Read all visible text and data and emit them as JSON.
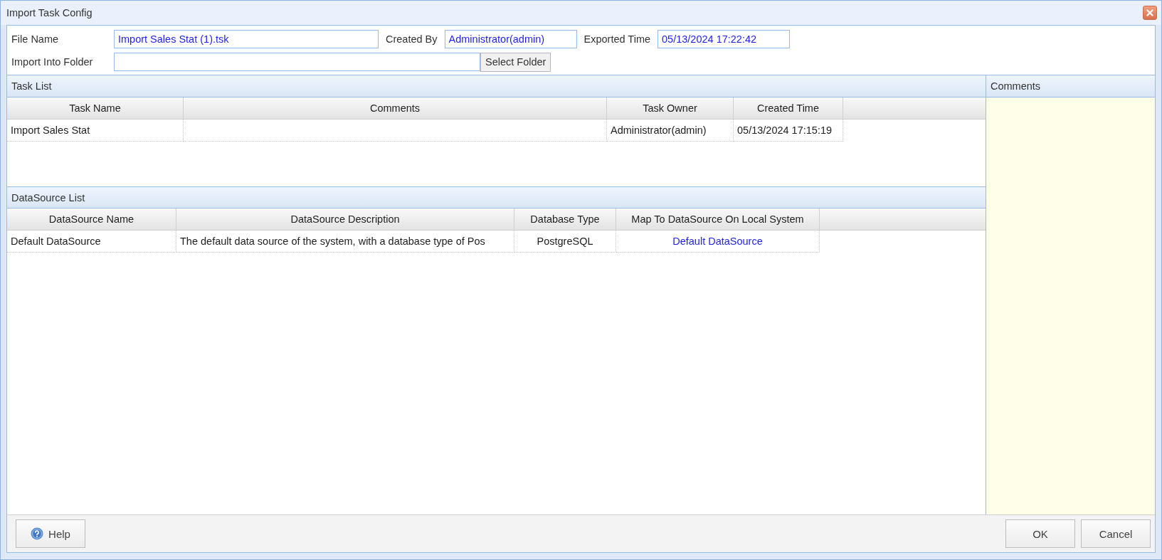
{
  "window": {
    "title": "Import Task Config"
  },
  "form": {
    "fields": [
      {
        "label": "File Name",
        "value": "Import Sales Stat (1).tsk"
      },
      {
        "label": "Created By",
        "value": "Administrator(admin)"
      },
      {
        "label": "Exported Time",
        "value": "05/13/2024 17:22:42"
      }
    ],
    "folder": {
      "label": "Import Into Folder",
      "button": "Select Folder"
    }
  },
  "task_list": {
    "title": "Task List",
    "columns": [
      "Task Name",
      "Comments",
      "Task Owner",
      "Created Time"
    ],
    "rows": [
      [
        "Import Sales Stat",
        "",
        "Administrator(admin)",
        "05/13/2024 17:15:19"
      ]
    ]
  },
  "datasource_list": {
    "title": "DataSource List",
    "columns": [
      "DataSource Name",
      "DataSource Description",
      "Database Type",
      "Map To DataSource On Local System"
    ],
    "rows": [
      [
        "Default DataSource",
        "The default data source of the system, with a database type of Pos",
        "PostgreSQL",
        "Default DataSource"
      ]
    ]
  },
  "comments_panel": {
    "title": "Comments"
  },
  "buttons": {
    "help": "Help",
    "ok": "OK",
    "cancel": "Cancel"
  }
}
